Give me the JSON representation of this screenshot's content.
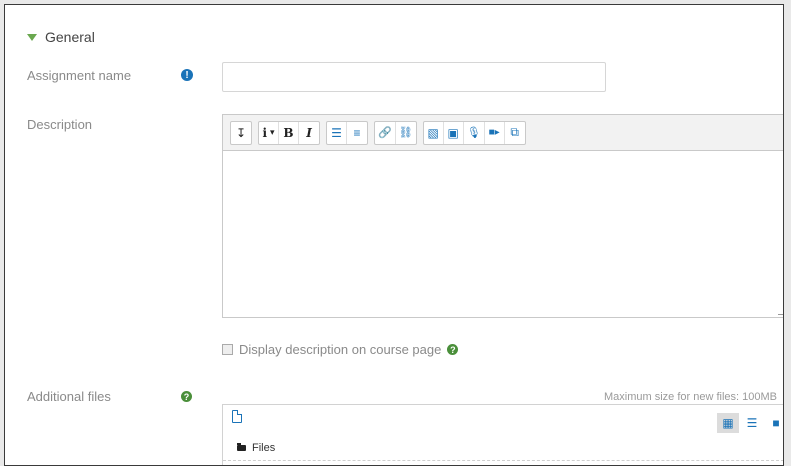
{
  "section": {
    "title": "General"
  },
  "assignment_name": {
    "label": "Assignment name",
    "value": "",
    "placeholder": "",
    "required_icon": "exclamation-icon"
  },
  "description": {
    "label": "Description",
    "toolbar": {
      "toggle": "↧",
      "paragraph": "i",
      "paragraph_caret": "▾",
      "bold": "B",
      "italic": "I",
      "unordered_list": "☰",
      "ordered_list": "≡",
      "link": "🔗",
      "unlink": "⛓",
      "image": "▧",
      "media": "▣",
      "record_audio": "🎙",
      "record_video": "■▸",
      "copy": "⧉"
    },
    "content": ""
  },
  "display_description": {
    "label": "Display description on course page",
    "checked": false,
    "help_icon": "question-icon"
  },
  "additional_files": {
    "label": "Additional files",
    "max_size": "Maximum size for new files: 100MB",
    "folder_label": "Files",
    "view_icons": [
      "grid-view-icon",
      "list-view-icon",
      "tree-view-icon"
    ]
  },
  "colors": {
    "accent": "#1a73b8",
    "help": "#4a8f3a",
    "label": "#8a8a8a"
  }
}
